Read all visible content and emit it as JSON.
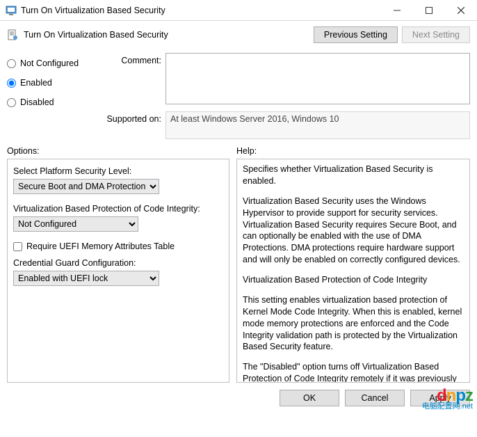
{
  "window": {
    "title": "Turn On Virtualization Based Security"
  },
  "header": {
    "policy_title": "Turn On Virtualization Based Security",
    "previous_setting": "Previous Setting",
    "next_setting": "Next Setting"
  },
  "state": {
    "not_configured": "Not Configured",
    "enabled": "Enabled",
    "disabled": "Disabled",
    "selected": "enabled"
  },
  "meta": {
    "comment_label": "Comment:",
    "comment_value": "",
    "supported_label": "Supported on:",
    "supported_value": "At least Windows Server 2016, Windows 10"
  },
  "labels": {
    "options": "Options:",
    "help": "Help:"
  },
  "options": {
    "platform_level_label": "Select Platform Security Level:",
    "platform_level_value": "Secure Boot and DMA Protection",
    "vbpci_label": "Virtualization Based Protection of Code Integrity:",
    "vbpci_value": "Not Configured",
    "uefi_mem_attr_label": "Require UEFI Memory Attributes Table",
    "uefi_mem_attr_checked": false,
    "credguard_label": "Credential Guard Configuration:",
    "credguard_value": "Enabled with UEFI lock"
  },
  "help": {
    "p1": "Specifies whether Virtualization Based Security is enabled.",
    "p2": "Virtualization Based Security uses the Windows Hypervisor to provide support for security services. Virtualization Based Security requires Secure Boot, and can optionally be enabled with the use of DMA Protections. DMA protections require hardware support and will only be enabled on correctly configured devices.",
    "p3": "Virtualization Based Protection of Code Integrity",
    "p4": "This setting enables virtualization based protection of Kernel Mode Code Integrity. When this is enabled, kernel mode memory protections are enforced and the Code Integrity validation path is protected by the Virtualization Based Security feature.",
    "p5": "The \"Disabled\" option turns off Virtualization Based Protection of Code Integrity remotely if it was previously turned on with the \"Enabled without lock\" option."
  },
  "footer": {
    "ok": "OK",
    "cancel": "Cancel",
    "apply": "Apply"
  },
  "watermark": {
    "brand": "dnpz",
    "domain": "电脑配置网.net"
  }
}
